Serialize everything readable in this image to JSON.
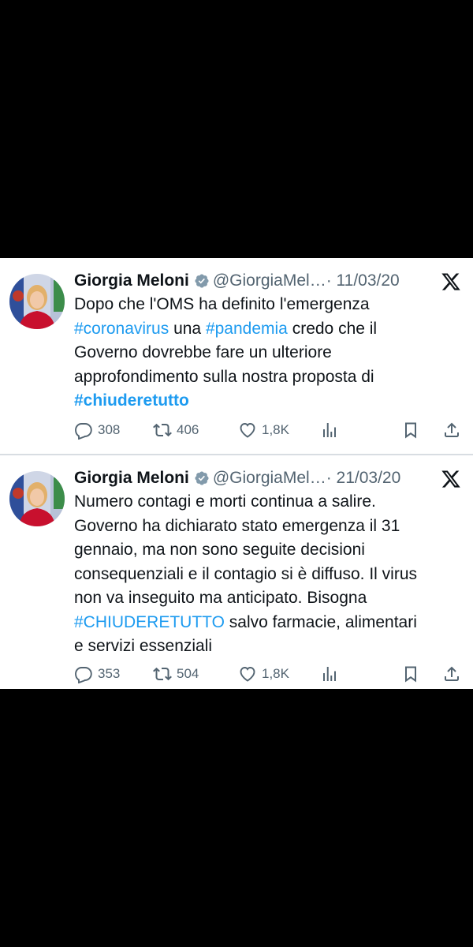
{
  "colors": {
    "link": "#1d9bf0",
    "text": "#0f1419",
    "muted": "#536471",
    "verified": "#829aab",
    "background": "#000000",
    "card": "#ffffff"
  },
  "icons": {
    "verified": "verified-badge-icon",
    "platform": "x-logo-icon",
    "reply": "reply-icon",
    "retweet": "retweet-icon",
    "like": "like-icon",
    "views": "views-icon",
    "bookmark": "bookmark-icon",
    "share": "share-icon"
  },
  "tweets": [
    {
      "author": {
        "name": "Giorgia Meloni",
        "handle": "@GiorgiaMel…",
        "date": "· 11/03/20"
      },
      "lines": [
        [
          {
            "text": "Dopo che l'OMS ha definito l'emergenza"
          }
        ],
        [
          {
            "text": "#coronavirus",
            "tag": true
          },
          {
            "text": " una "
          },
          {
            "text": "#pandemia",
            "tag": true
          },
          {
            "text": " credo che il"
          }
        ],
        [
          {
            "text": "Governo dovrebbe fare un ulteriore"
          }
        ],
        [
          {
            "text": "approfondimento sulla nostra proposta di"
          }
        ],
        [
          {
            "text": "#chiuderetutto",
            "tag": true,
            "bold": true
          }
        ]
      ],
      "stats": {
        "replies": "308",
        "retweets": "406",
        "likes": "1,8K"
      }
    },
    {
      "author": {
        "name": "Giorgia Meloni",
        "handle": "@GiorgiaMel…",
        "date": "· 21/03/20"
      },
      "lines": [
        [
          {
            "text": "Numero contagi e morti continua a salire."
          }
        ],
        [
          {
            "text": "Governo ha dichiarato stato emergenza il 31"
          }
        ],
        [
          {
            "text": "gennaio, ma non sono seguite decisioni"
          }
        ],
        [
          {
            "text": "consequenziali e il contagio si è diffuso. Il virus"
          }
        ],
        [
          {
            "text": "non va inseguito ma anticipato. Bisogna"
          }
        ],
        [
          {
            "text": "#CHIUDERETUTTO",
            "tag": true
          },
          {
            "text": " salvo farmacie, alimentari"
          }
        ],
        [
          {
            "text": "e servizi essenziali"
          }
        ]
      ],
      "stats": {
        "replies": "353",
        "retweets": "504",
        "likes": "1,8K"
      }
    }
  ]
}
